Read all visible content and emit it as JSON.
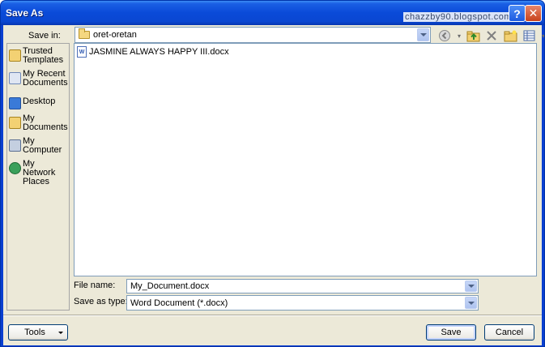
{
  "window": {
    "title": "Save As",
    "watermark": "chazzby90.blogspot.com",
    "help_glyph": "?",
    "close_glyph": "✕"
  },
  "save_in": {
    "label": "Save in:",
    "value": "oret-oretan"
  },
  "toolbar": {
    "icons": [
      "back-icon",
      "dropdown-icon",
      "up-folder-icon",
      "delete-icon",
      "new-folder-icon",
      "views-icon",
      "views-dropdown-icon"
    ]
  },
  "places": [
    {
      "label": "Trusted Templates",
      "icon": "trusted-templates-icon"
    },
    {
      "label": "My Recent Documents",
      "icon": "recent-documents-icon"
    },
    {
      "label": "Desktop",
      "icon": "desktop-icon"
    },
    {
      "label": "My Documents",
      "icon": "my-documents-icon"
    },
    {
      "label": "My Computer",
      "icon": "my-computer-icon"
    },
    {
      "label": "My Network Places",
      "icon": "network-places-icon"
    }
  ],
  "files": [
    {
      "name": "JASMINE ALWAYS HAPPY III.docx",
      "icon": "word-document-icon"
    }
  ],
  "file_name": {
    "label": "File name:",
    "value": "My_Document.docx"
  },
  "save_as_type": {
    "label": "Save as type:",
    "value": "Word Document (*.docx)"
  },
  "buttons": {
    "tools": "Tools",
    "save": "Save",
    "cancel": "Cancel"
  },
  "colors": {
    "titlebar": "#0a4ad8",
    "dialog_bg": "#ece9d8",
    "close_button": "#c8421c"
  }
}
